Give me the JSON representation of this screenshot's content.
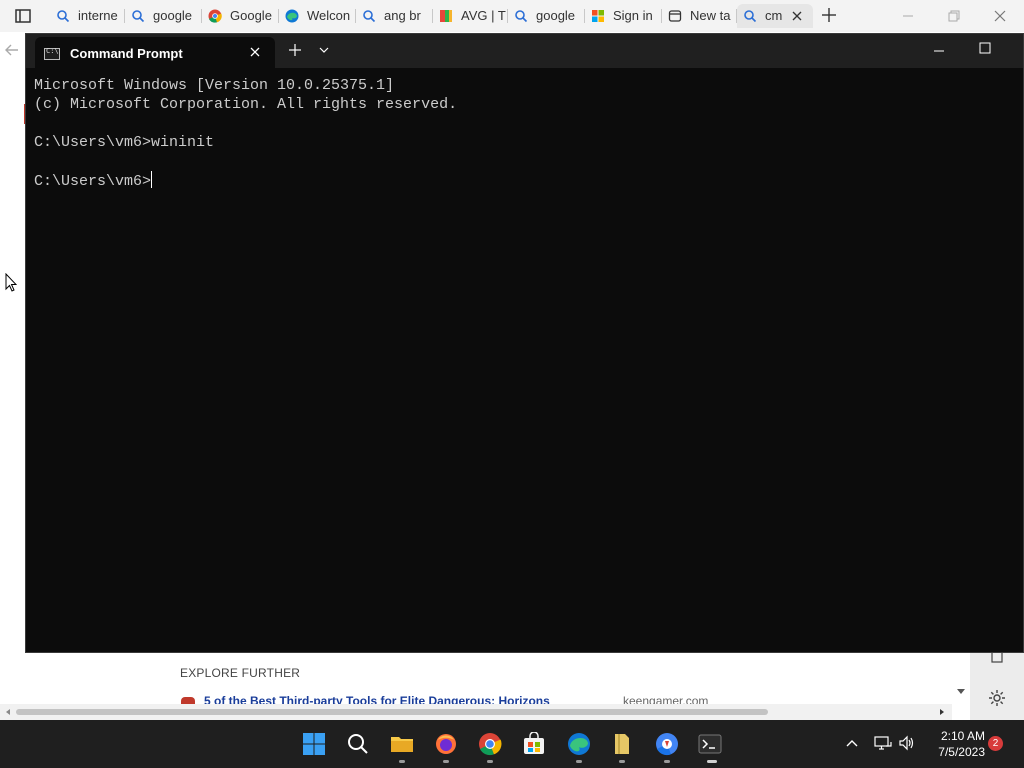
{
  "browser": {
    "tabs": [
      {
        "label": "interne",
        "icon": "search-icon"
      },
      {
        "label": "google",
        "icon": "search-icon"
      },
      {
        "label": "Google",
        "icon": "chrome-icon"
      },
      {
        "label": "Welcon",
        "icon": "edge-icon"
      },
      {
        "label": "ang br",
        "icon": "search-icon"
      },
      {
        "label": "AVG | T",
        "icon": "avg-icon"
      },
      {
        "label": "google",
        "icon": "search-icon"
      },
      {
        "label": "Sign in",
        "icon": "microsoft-icon"
      },
      {
        "label": "New ta",
        "icon": "newtab-page-icon"
      },
      {
        "label": "cm",
        "icon": "search-icon"
      }
    ],
    "content": {
      "explore_heading": "EXPLORE FURTHER",
      "link_text": "5 of the Best Third-party Tools for Elite Dangerous: Horizons",
      "link_source": "keengamer.com"
    }
  },
  "terminal": {
    "tab_title": "Command Prompt",
    "lines": [
      "Microsoft Windows [Version 10.0.25375.1]",
      "(c) Microsoft Corporation. All rights reserved.",
      "",
      "C:\\Users\\vm6>wininit",
      ""
    ],
    "prompt": "C:\\Users\\vm6>"
  },
  "taskbar": {
    "apps": [
      "start-icon",
      "search-icon",
      "file-explorer-icon",
      "firefox-icon",
      "chrome-icon",
      "microsoft-store-icon",
      "edge-icon",
      "folder-icon",
      "chrome-beta-icon",
      "terminal-icon"
    ],
    "clock": {
      "time": "2:10 AM",
      "date": "7/5/2023"
    },
    "notification_count": "2"
  },
  "colors": {
    "terminal_bg": "#0c0c0c",
    "terminal_text": "#cccccc",
    "taskbar_bg": "#1f1f1f",
    "notification_badge": "#d83b3b"
  }
}
